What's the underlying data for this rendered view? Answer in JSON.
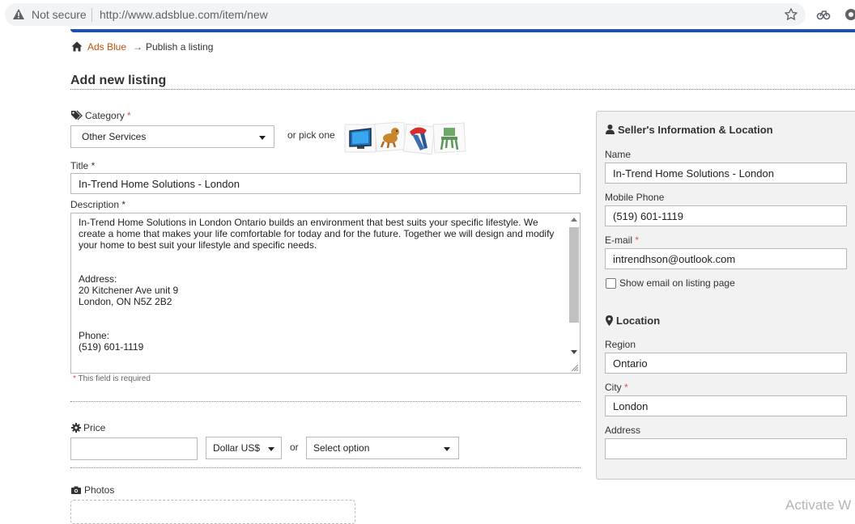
{
  "browser": {
    "security": "Not secure",
    "url": "http://www.adsblue.com/item/new"
  },
  "breadcrumb": {
    "home_label": "Ads Blue",
    "separator": "→",
    "current": "Publish a listing"
  },
  "page_title": "Add new listing",
  "required_mark": "*",
  "form": {
    "category": {
      "label": "Category",
      "value": "Other Services",
      "pick_text": "or pick one",
      "quick_icons": [
        "tv-monitor-icon",
        "dog-icon",
        "clothing-icon",
        "chair-icon"
      ]
    },
    "title": {
      "label": "Title",
      "value": "In-Trend Home Solutions - London"
    },
    "description": {
      "label": "Description",
      "value": "In-Trend Home Solutions in London Ontario builds an environment that best suits your specific lifestyle. We create a home that makes your life comfortable for today and for the future. Together we will design and modify your home to best suit your lifestyle and specific needs.\n\n\nAddress:\n20 Kitchener Ave unit 9\nLondon, ON N5Z 2B2\n\n\nPhone:\n(519) 601-1119",
      "required_note": "This field is required"
    },
    "price": {
      "label": "Price",
      "value": "",
      "currency": "Dollar US$",
      "or_text": "or",
      "option": "Select option"
    },
    "photos": {
      "label": "Photos"
    }
  },
  "seller": {
    "heading": "Seller's Information & Location",
    "name_label": "Name",
    "name": "In-Trend Home Solutions - London",
    "phone_label": "Mobile Phone",
    "phone": "(519) 601-1119",
    "email_label": "E-mail",
    "email": "intrendhson@outlook.com",
    "show_email_label": "Show email on listing page",
    "show_email_checked": false,
    "location_heading": "Location",
    "region_label": "Region",
    "region": "Ontario",
    "city_label": "City",
    "city": "London",
    "address_label": "Address",
    "address": ""
  },
  "watermark": "Activate W",
  "colors": {
    "accent_bar": "#1d4fb0",
    "link": "#c0530f",
    "required": "#d9534f"
  }
}
